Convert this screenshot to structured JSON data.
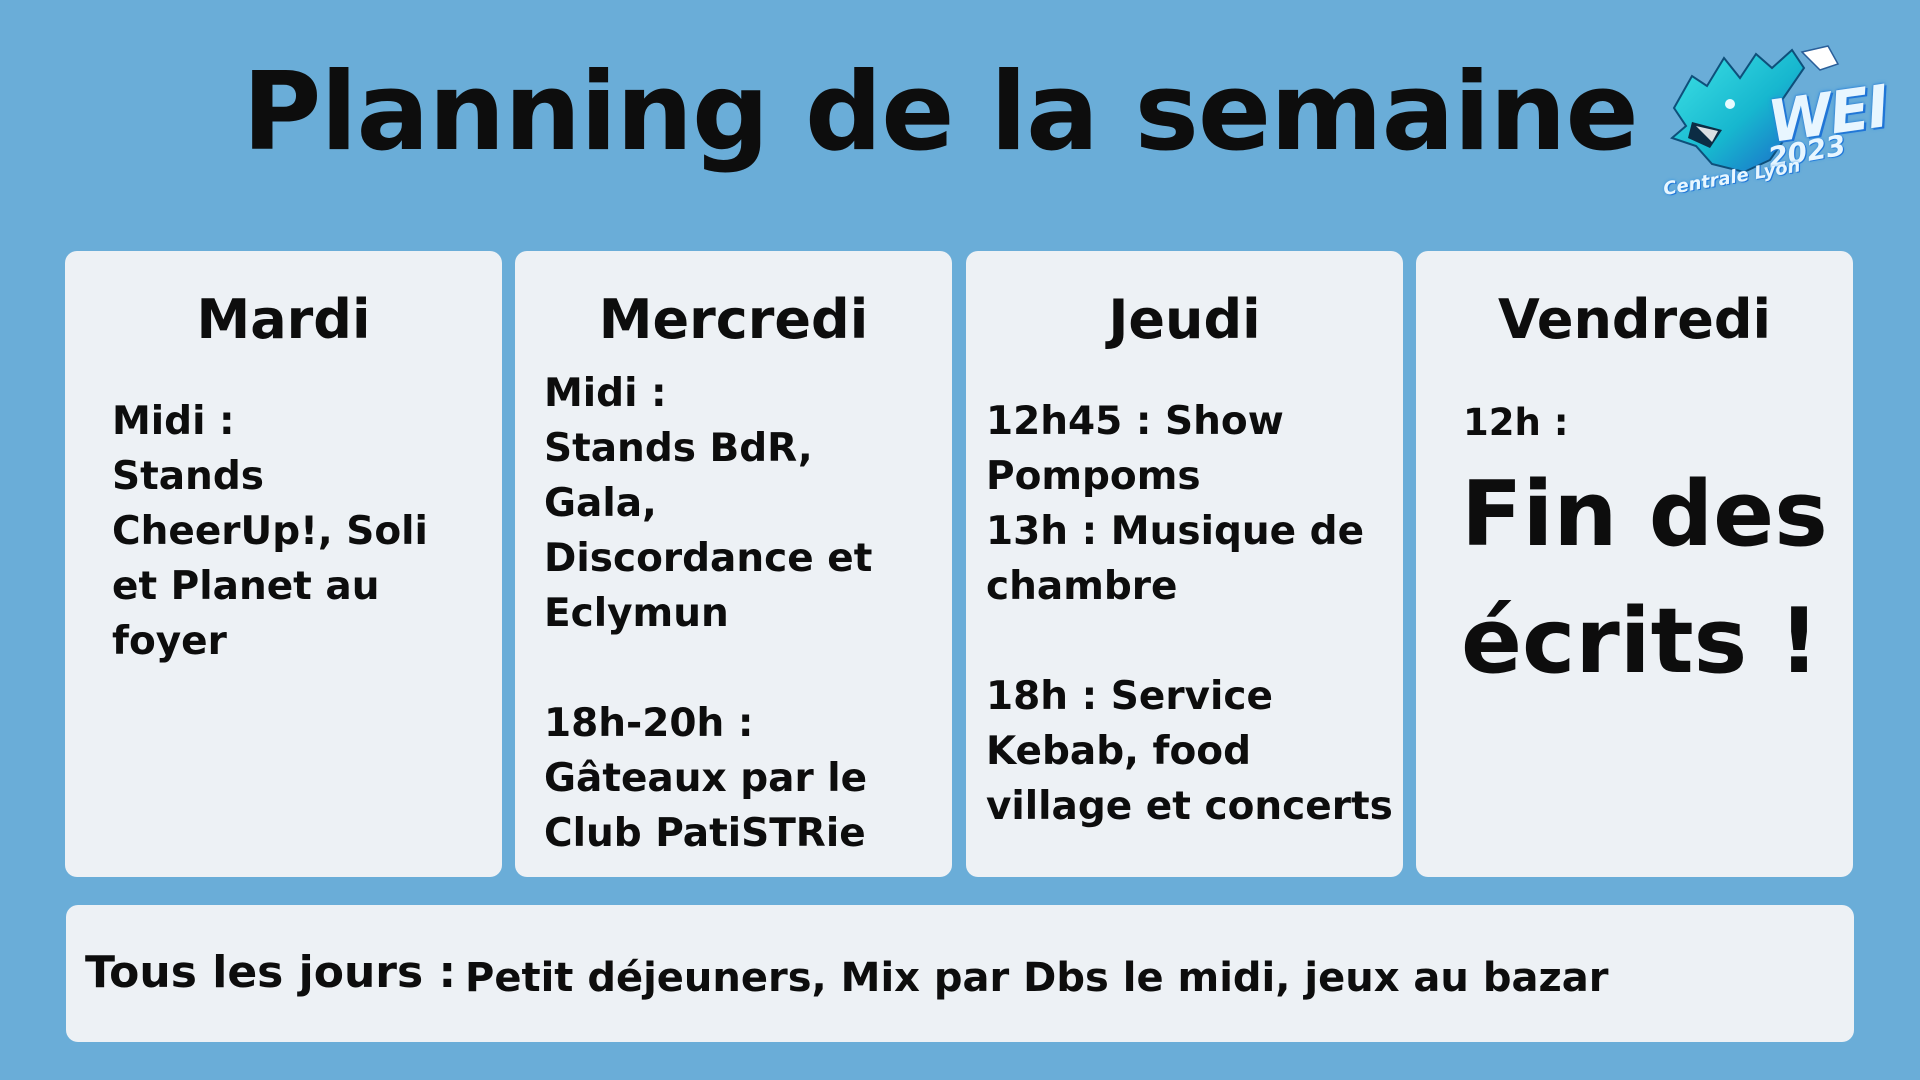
{
  "header": {
    "title": "Planning de la semaine"
  },
  "logo": {
    "name": "wolf-logo",
    "wei": "WEI",
    "year": "2023",
    "subtitle": "Centrale Lyon",
    "colors": [
      "#1ec8d8",
      "#2a7fe0",
      "#e8f6ff"
    ]
  },
  "days": [
    {
      "name": "Mardi",
      "text": "Midi :\nStands\nCheerUp!, Soli\net Planet  au\nfoyer"
    },
    {
      "name": "Mercredi",
      "text": "Midi :\nStands  BdR,\nGala,\nDiscordance et\nEclymun\n\n18h-20h :\nGâteaux par le\nClub PatiSTRie"
    },
    {
      "name": "Jeudi",
      "text": "12h45 : Show\nPompoms\n13h : Musique de\nchambre\n\n18h : Service\nKebab, food\nvillage et concerts"
    },
    {
      "name": "Vendredi",
      "time": "12h :",
      "highlight": "Fin des\nécrits !"
    }
  ],
  "footer": {
    "label": "Tous les jours :",
    "text": "Petit déjeuners, Mix par Dbs le midi, jeux au bazar"
  },
  "colors": {
    "background": "#6aadd8",
    "card": "#edf1f5",
    "text": "#0d0d0d"
  }
}
